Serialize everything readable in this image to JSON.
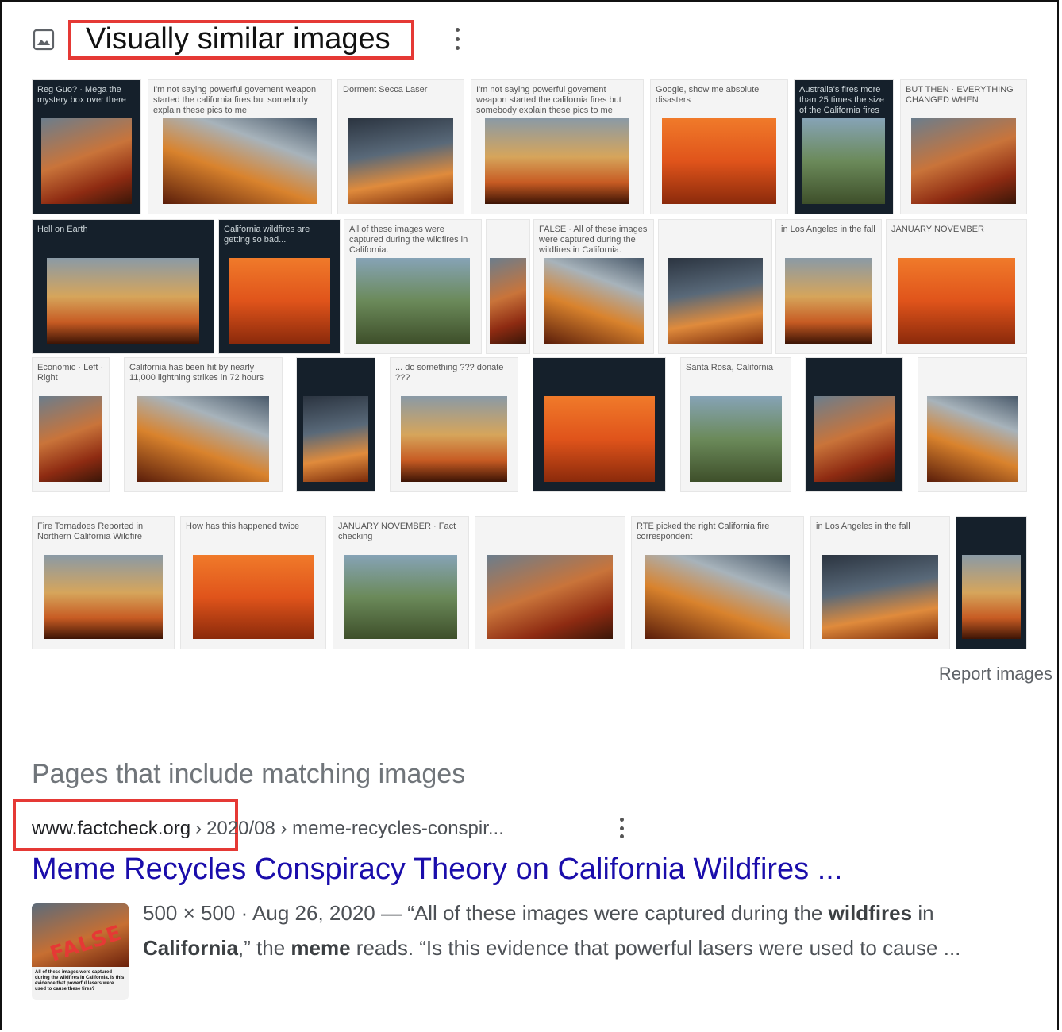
{
  "header": {
    "icon": "image-icon",
    "title": "Visually similar images"
  },
  "tiles": [
    [
      {
        "caption": "Reg Guo? · Mega the mystery box over there",
        "style": "dark"
      },
      {
        "caption": "I'm not saying powerful govement weapon started the california fires but somebody explain these pics to me",
        "style": "light"
      },
      {
        "caption": "Dorment Secca Laser",
        "style": "light"
      },
      {
        "caption": "I'm not saying powerful govement weapon started the california fires but somebody explain these pics to me",
        "style": "light"
      },
      {
        "caption": "Google, show me absolute disasters",
        "style": "light"
      },
      {
        "caption": "Australia's fires more than 25 times the size of the California fires",
        "style": "dark"
      },
      {
        "caption": "BUT THEN · EVERYTHING CHANGED WHEN",
        "style": "light"
      }
    ],
    [
      {
        "caption": "Hell on Earth",
        "style": "dark"
      },
      {
        "caption": "California wildfires are getting so bad...",
        "style": "dark"
      },
      {
        "caption": "All of these images were captured during the wildfires in California.",
        "style": "light"
      },
      {
        "caption": "",
        "style": "light"
      },
      {
        "caption": "FALSE · All of these images were captured during the wildfires in California.",
        "style": "light"
      },
      {
        "caption": "",
        "style": "light"
      },
      {
        "caption": "in Los Angeles in the fall",
        "style": "light"
      },
      {
        "caption": "JANUARY NOVEMBER",
        "style": "light"
      }
    ],
    [
      {
        "caption": "Economic · Left · Right",
        "style": "light"
      },
      {
        "caption": "California has been hit by nearly 11,000 lightning strikes in 72 hours",
        "style": "light"
      },
      {
        "caption": "",
        "style": "dark"
      },
      {
        "caption": "... do something ??? donate ???",
        "style": "light"
      },
      {
        "caption": "",
        "style": "dark"
      },
      {
        "caption": "Santa Rosa, California",
        "style": "light"
      },
      {
        "caption": "",
        "style": "dark"
      },
      {
        "caption": "",
        "style": "light"
      }
    ],
    [
      {
        "caption": "Fire Tornadoes Reported in Northern California Wildfire",
        "style": "light"
      },
      {
        "caption": "How has this happened twice",
        "style": "light"
      },
      {
        "caption": "JANUARY NOVEMBER · Fact checking",
        "style": "light"
      },
      {
        "caption": "",
        "style": "light"
      },
      {
        "caption": "RTE picked the right California fire correspondent",
        "style": "light"
      },
      {
        "caption": "in Los Angeles in the fall",
        "style": "light"
      },
      {
        "caption": "",
        "style": "dark"
      }
    ]
  ],
  "report_link": "Report images",
  "pages_section": {
    "title": "Pages that include matching images",
    "site": "www.factcheck.org",
    "separator": "›",
    "path": "2020/08 › meme-recycles-conspir...",
    "result_title": "Meme Recycles Conspiracy Theory on California Wildfires ...",
    "thumbnail": {
      "stamp": "FALSE",
      "caption": "All of these images were captured during the wildfires in California. Is this evidence that powerful lasers were used to cause these fires?"
    },
    "snippet": {
      "meta": "500 × 500 · Aug 26, 2020 —",
      "parts": [
        "“All of these images were captured during the ",
        "wildfires",
        " in ",
        "California",
        ",” the ",
        "meme",
        " reads. “Is this evidence that powerful lasers were used to cause ..."
      ]
    }
  }
}
